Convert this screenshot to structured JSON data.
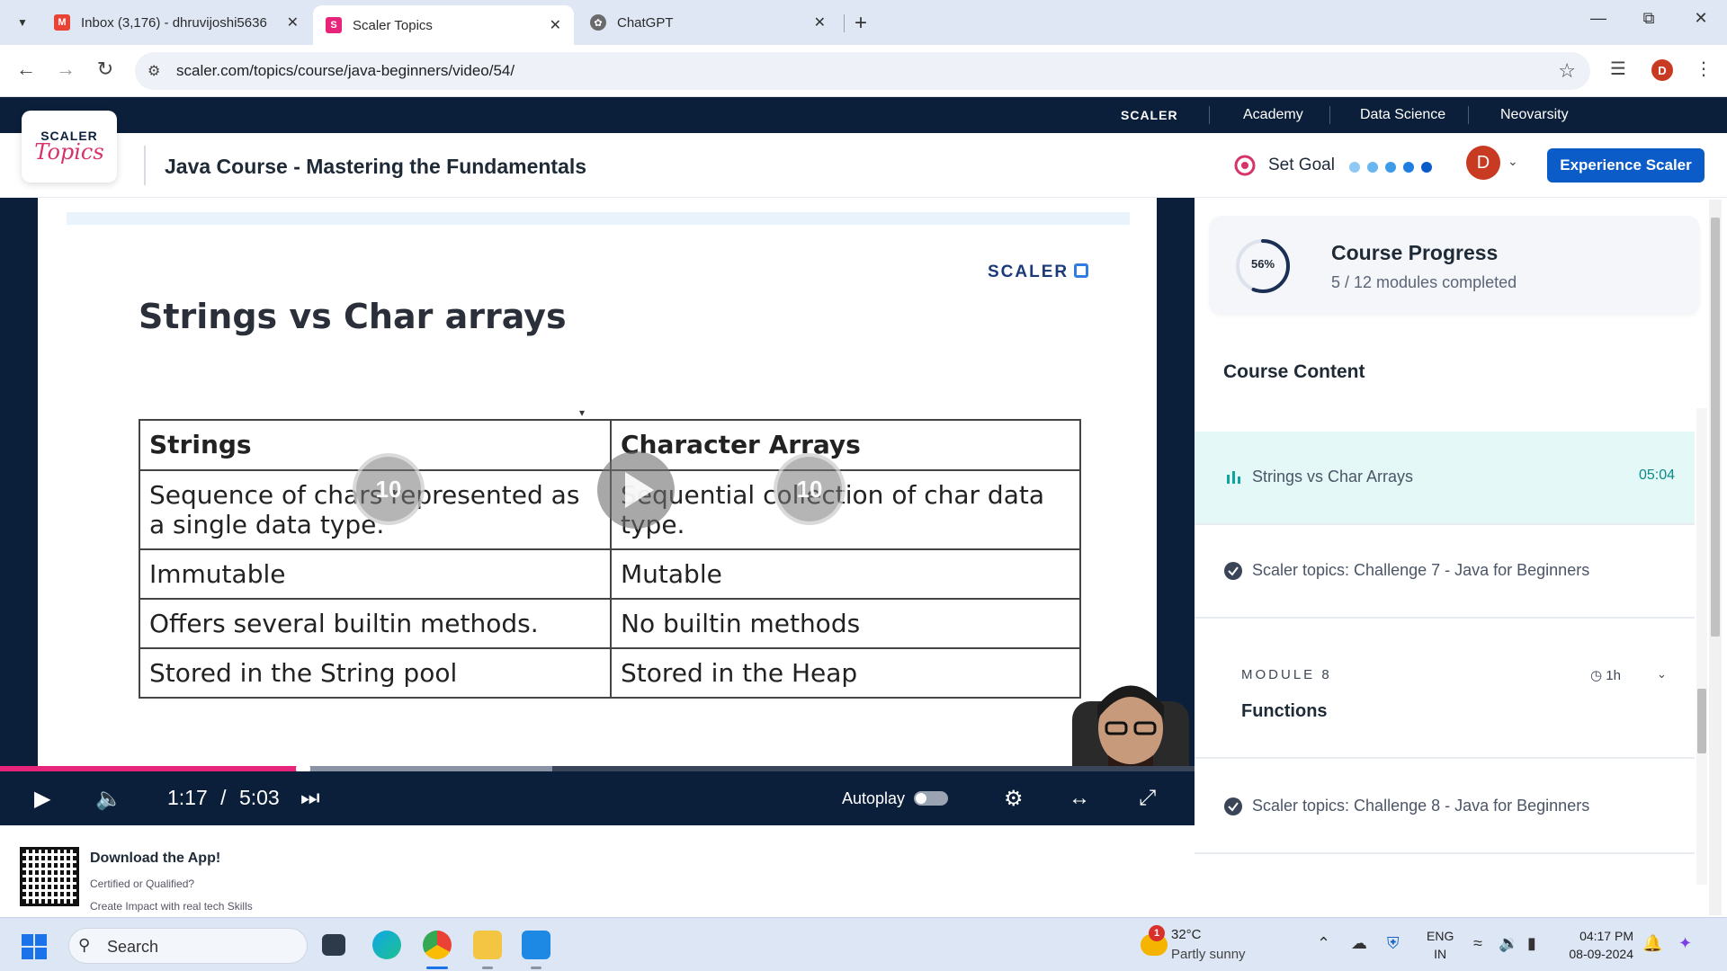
{
  "browser": {
    "tabs": [
      {
        "title": "Inbox (3,176) - dhruvijoshi5636",
        "favicon": "gmail-icon",
        "active": false
      },
      {
        "title": "Scaler Topics",
        "favicon": "scaler-topics-icon",
        "active": true
      },
      {
        "title": "ChatGPT",
        "favicon": "chatgpt-icon",
        "active": false
      }
    ],
    "url": "scaler.com/topics/course/java-beginners/video/54/",
    "profile_initial": "D"
  },
  "site": {
    "top_nav": {
      "brand": "SCALER",
      "links": [
        "Academy",
        "Data Science",
        "Neovarsity"
      ]
    },
    "logo": {
      "line1": "SCALER",
      "line2": "Topics"
    },
    "course_title": "Java Course - Mastering the Fundamentals",
    "set_goal_label": "Set Goal",
    "goal_dot_colors": [
      "#8ec9f5",
      "#6ab6f0",
      "#3f9be8",
      "#1f7fe0",
      "#0b5cc8"
    ],
    "avatar_initial": "D",
    "cta_label": "Experience Scaler",
    "accent": "#0b5cc8"
  },
  "video": {
    "slide_brand": "SCALER",
    "slide_title": "Strings vs Char arrays",
    "table": {
      "headers": [
        "Strings",
        "Character Arrays"
      ],
      "rows": [
        [
          "Sequence of chars represented as a single data type.",
          "Sequential collection of char data type."
        ],
        [
          "Immutable",
          "Mutable"
        ],
        [
          "Offers several builtin methods.",
          "No builtin methods"
        ],
        [
          "Stored in the String pool",
          "Stored in the Heap"
        ]
      ]
    },
    "rewind_label": "10",
    "forward_label": "10",
    "current_time": "1:17",
    "time_separator": "/",
    "duration": "5:03",
    "played_fraction": 0.254,
    "buffered_fraction": 0.462,
    "autoplay_label": "Autoplay",
    "autoplay_on": false,
    "progress_color": "#e5247a"
  },
  "download": {
    "title": "Download the App!",
    "line1": "Certified or Qualified?",
    "line2": "Create Impact with real tech Skills"
  },
  "sidebar": {
    "progress": {
      "percent_label": "56%",
      "percent": 56,
      "title": "Course Progress",
      "subtitle": "5 / 12 modules completed"
    },
    "content_title": "Course Content",
    "items": [
      {
        "label": "Strings vs Char Arrays",
        "time": "05:04",
        "active": true,
        "icon": "playing-icon"
      },
      {
        "label": "Scaler topics: Challenge 7 - Java for Beginners",
        "time": "",
        "active": false,
        "icon": "challenge-icon"
      }
    ],
    "module": {
      "kicker": "MODULE 8",
      "title": "Functions",
      "duration": "1h"
    },
    "items_after": [
      {
        "label": "Scaler topics: Challenge 8 - Java for Beginners",
        "icon": "challenge-icon"
      }
    ]
  },
  "taskbar": {
    "search_placeholder": "Search",
    "weather": {
      "temp": "32°C",
      "desc": "Partly sunny",
      "badge": "1"
    },
    "lang": {
      "line1": "ENG",
      "line2": "IN"
    },
    "clock": {
      "time": "04:17 PM",
      "date": "08-09-2024"
    }
  }
}
